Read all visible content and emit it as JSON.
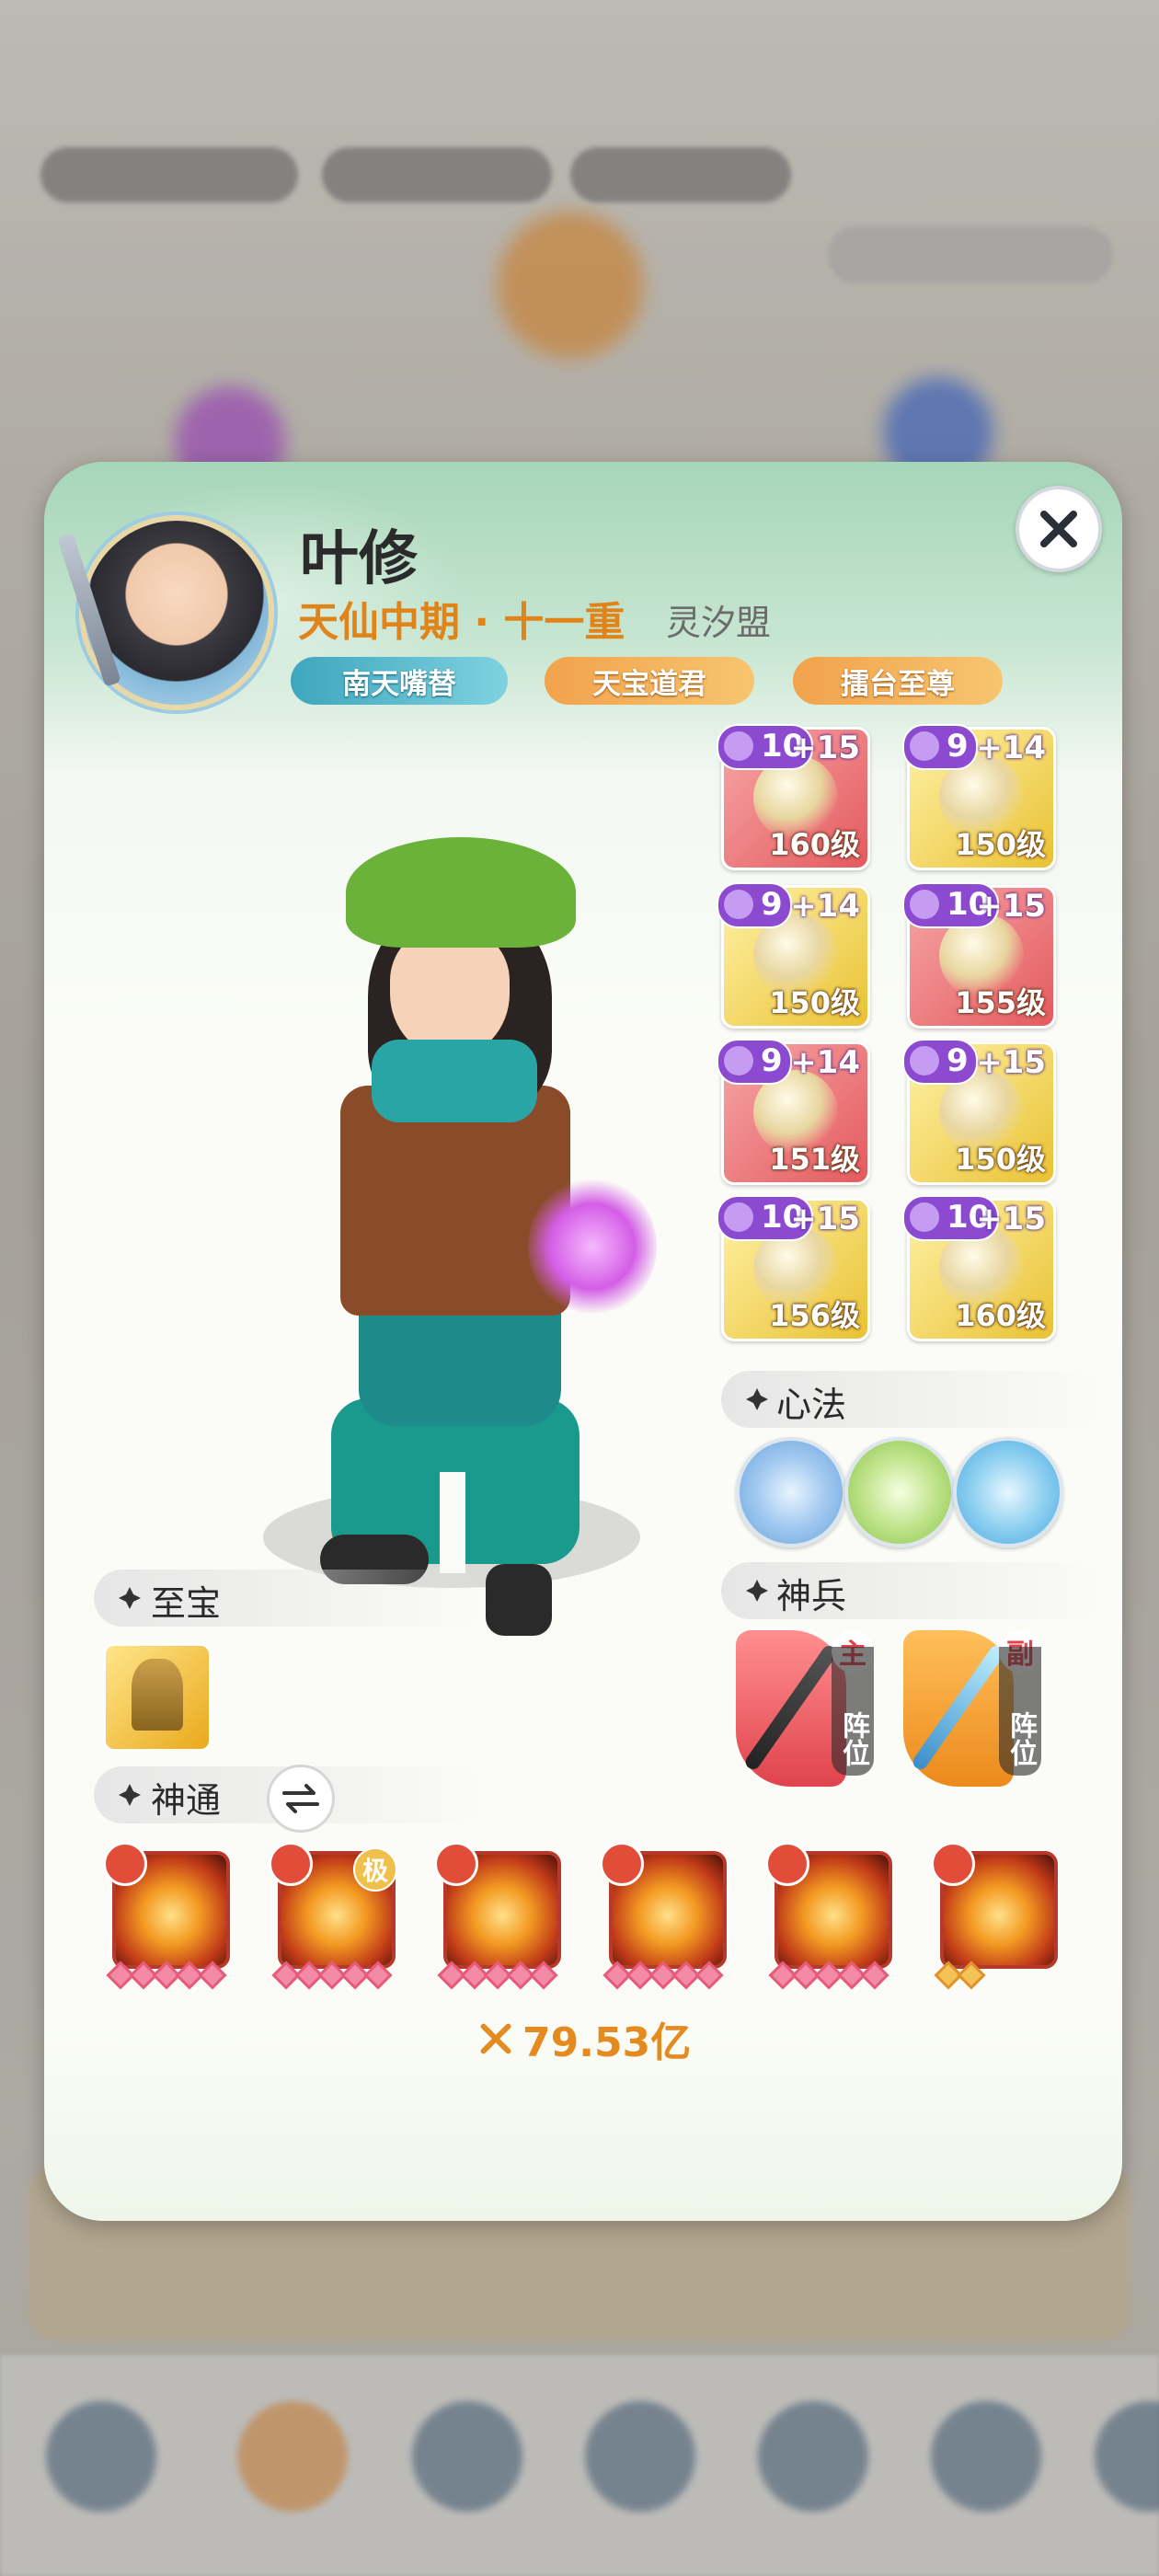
{
  "player": {
    "name": "叶修",
    "realm": "天仙中期 · 十一重",
    "guild": "灵汐盟",
    "titles": [
      "南天嘴替",
      "天宝道君",
      "擂台至尊"
    ]
  },
  "equipment": [
    {
      "gem": "10",
      "enhance": "+15",
      "level": "160级",
      "rarity": "red"
    },
    {
      "gem": "9",
      "enhance": "+14",
      "level": "150级",
      "rarity": "gold"
    },
    {
      "gem": "9",
      "enhance": "+14",
      "level": "150级",
      "rarity": "gold"
    },
    {
      "gem": "10",
      "enhance": "+15",
      "level": "155级",
      "rarity": "red"
    },
    {
      "gem": "9",
      "enhance": "+14",
      "level": "151级",
      "rarity": "red"
    },
    {
      "gem": "9",
      "enhance": "+15",
      "level": "150级",
      "rarity": "gold"
    },
    {
      "gem": "10",
      "enhance": "+15",
      "level": "156级",
      "rarity": "gold"
    },
    {
      "gem": "10",
      "enhance": "+15",
      "level": "160级",
      "rarity": "gold"
    }
  ],
  "sections": {
    "xinfa": "心法",
    "shenbing": "神兵",
    "zhibao": "至宝",
    "shentong": "神通"
  },
  "weapons": [
    {
      "slot": "主",
      "tag": "阵位"
    },
    {
      "slot": "副",
      "tag": "阵位"
    }
  ],
  "skills": [
    {
      "stars_filled": 5,
      "stars_total": 5,
      "grade_badge": ""
    },
    {
      "stars_filled": 5,
      "stars_total": 5,
      "grade_badge": "极"
    },
    {
      "stars_filled": 5,
      "stars_total": 5,
      "grade_badge": ""
    },
    {
      "stars_filled": 5,
      "stars_total": 5,
      "grade_badge": ""
    },
    {
      "stars_filled": 5,
      "stars_total": 5,
      "grade_badge": ""
    },
    {
      "stars_filled": 2,
      "stars_total": 2,
      "grade_badge": ""
    }
  ],
  "combat_power": "79.53亿",
  "icons": {
    "close": "close-icon",
    "swap": "swap-icon",
    "power": "crossed-swords-icon"
  },
  "colors": {
    "realm": "#e08419",
    "power": "#e58a1f"
  }
}
